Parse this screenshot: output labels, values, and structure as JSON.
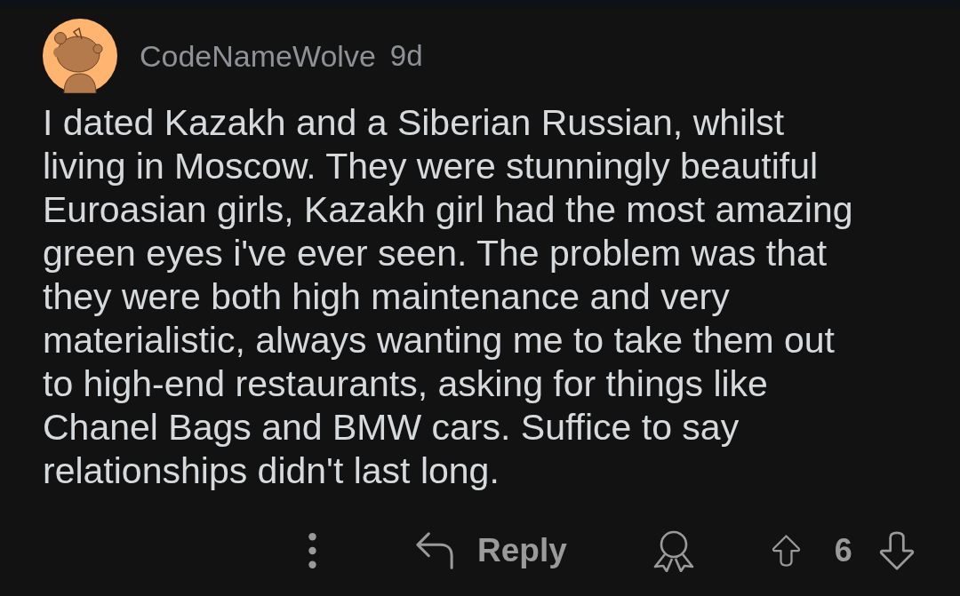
{
  "comment": {
    "author": "CodeNameWolve",
    "age": "9d",
    "body": "I dated Kazakh and a Siberian Russian, whilst living in Moscow. They were stunningly beautiful Euroasian girls, Kazakh girl had the most amazing green eyes i've ever seen. The problem was that they were both high maintenance and very materialistic, always wanting me to take them out to high-end restaurants, asking for things like Chanel Bags and BMW cars. Suffice to say relationships didn't last long."
  },
  "actions": {
    "reply_label": "Reply",
    "score": "6"
  }
}
